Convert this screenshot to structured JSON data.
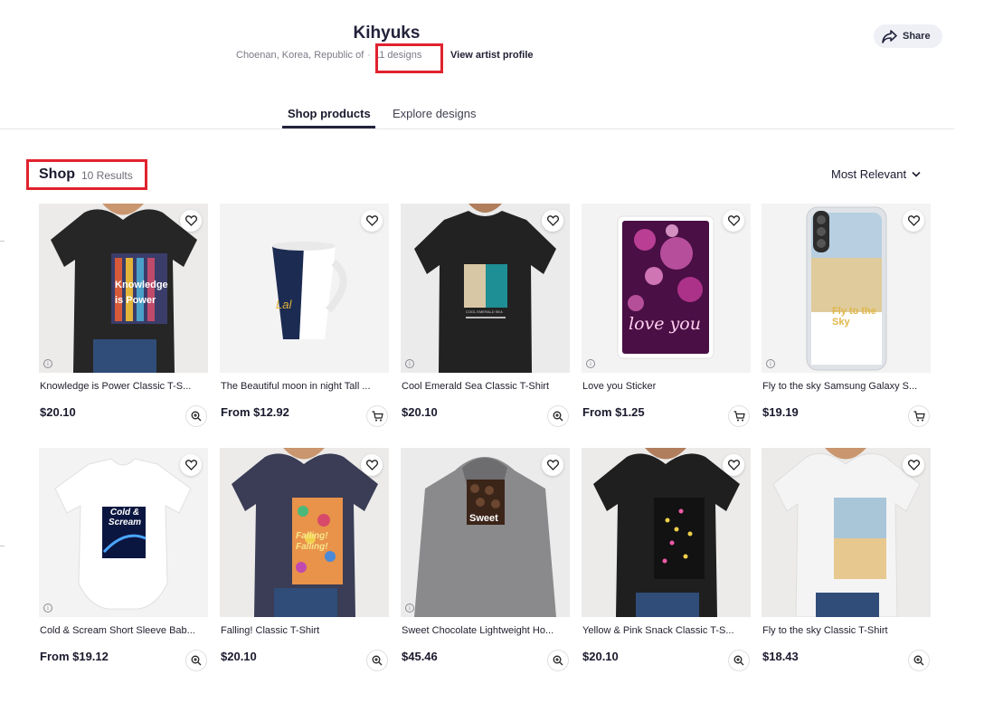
{
  "header": {
    "artist_name": "Kihyuks",
    "location": "Choenan, Korea, Republic of",
    "separator": "·",
    "designs_count": "11 designs",
    "view_profile": "View artist profile",
    "share_label": "Share"
  },
  "tabs": [
    {
      "label": "Shop products",
      "active": true
    },
    {
      "label": "Explore designs",
      "active": false
    }
  ],
  "shop": {
    "title": "Shop",
    "results": "10 Results",
    "sort_label": "Most Relevant"
  },
  "products": [
    {
      "title": "Knowledge is Power Classic T-S...",
      "price": "$20.10",
      "action": "zoom-icon"
    },
    {
      "title": "The Beautiful moon in night Tall ...",
      "price": "From $12.92",
      "action": "cart-icon"
    },
    {
      "title": "Cool Emerald Sea Classic T-Shirt",
      "price": "$20.10",
      "action": "zoom-icon"
    },
    {
      "title": "Love you Sticker",
      "price": "From $1.25",
      "action": "cart-icon"
    },
    {
      "title": "Fly to the sky Samsung Galaxy S...",
      "price": "$19.19",
      "action": "cart-icon"
    },
    {
      "title": "Cold & Scream Short Sleeve Bab...",
      "price": "From $19.12",
      "action": "zoom-icon"
    },
    {
      "title": "Falling! Classic T-Shirt",
      "price": "$20.10",
      "action": "zoom-icon"
    },
    {
      "title": "Sweet Chocolate Lightweight Ho...",
      "price": "$45.46",
      "action": "zoom-icon"
    },
    {
      "title": "Yellow & Pink Snack Classic T-S...",
      "price": "$20.10",
      "action": "zoom-icon"
    },
    {
      "title": "Fly to the sky Classic T-Shirt",
      "price": "$18.43",
      "action": "zoom-icon"
    }
  ],
  "design_text": {
    "knowledge": "Knowledge is Power",
    "moon": "Lal",
    "emerald": "COOL EMERALD SEA",
    "love": "love you",
    "sky": "Fly to the Sky",
    "cold": "Cold & Scream",
    "falling": "Falling! Falling!",
    "sweet": "Sweet"
  },
  "colors": {
    "highlight_box": "#e0232e",
    "text_primary": "#1a1a2e"
  }
}
